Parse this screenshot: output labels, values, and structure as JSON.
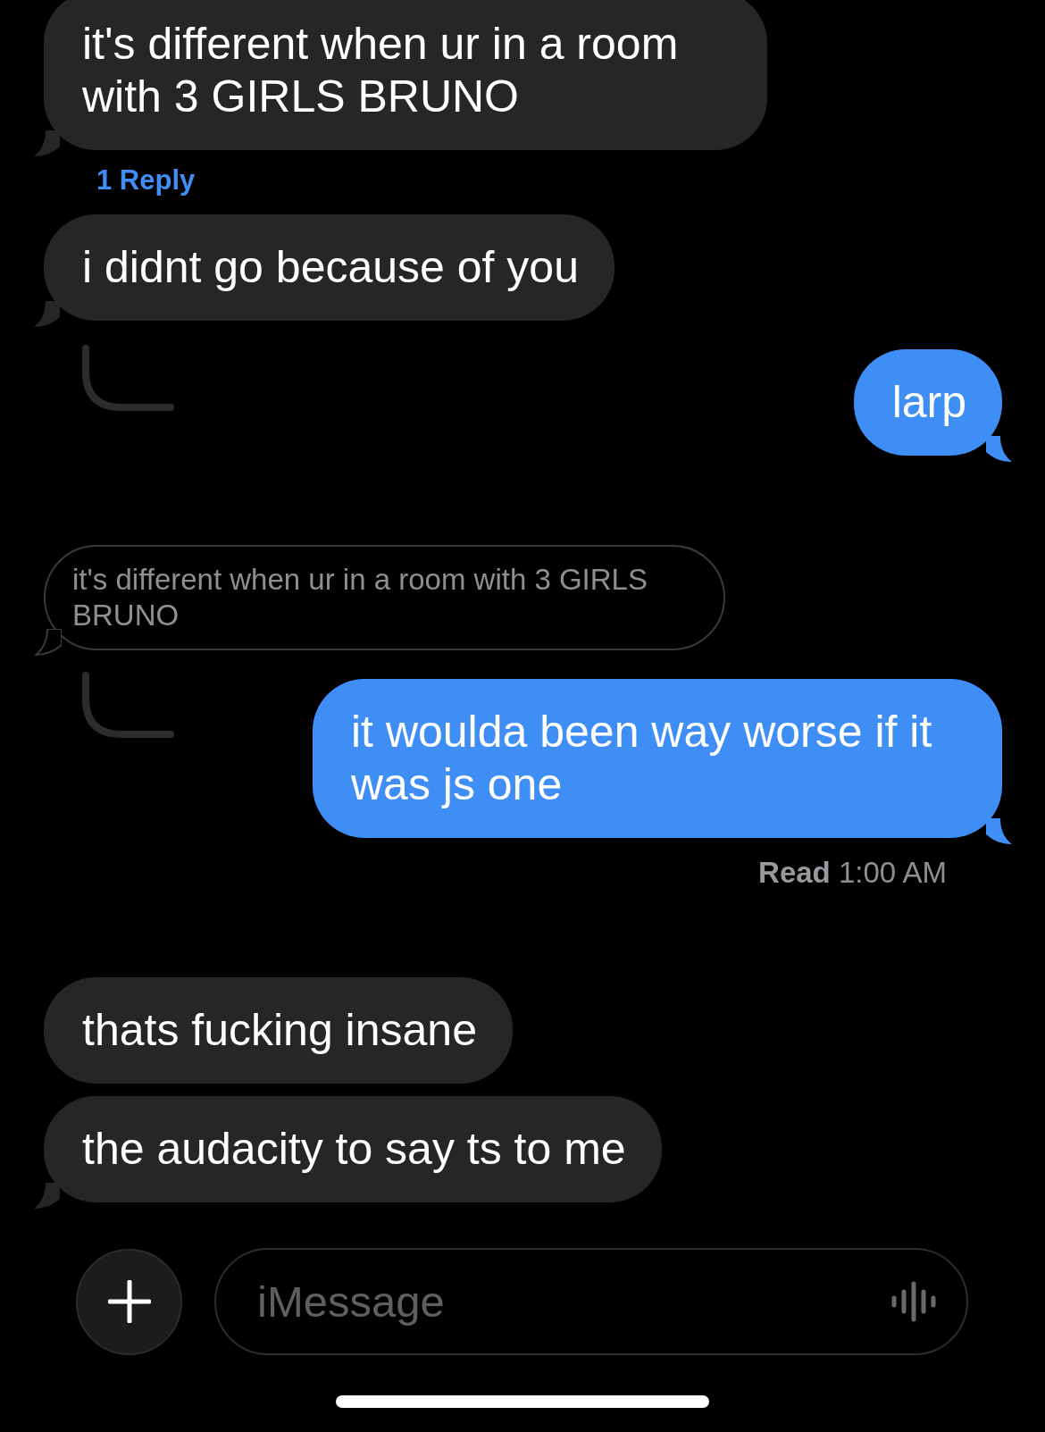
{
  "messages": [
    {
      "kind": "incoming",
      "text": "it's different when ur in a room with 3 GIRLS BRUNO",
      "tail": true
    },
    {
      "kind": "reply_link",
      "text": "1 Reply"
    },
    {
      "kind": "incoming",
      "text": "i didnt go because of you",
      "tail": true
    },
    {
      "kind": "outgoing",
      "text": "larp",
      "tail": true,
      "thread_line": true
    },
    {
      "kind": "quote",
      "text": "it's different when ur in a room with 3 GIRLS BRUNO",
      "tail": true
    },
    {
      "kind": "outgoing",
      "text": "it woulda been way worse if it was js one",
      "tail": true,
      "thread_line": true
    },
    {
      "kind": "receipt",
      "text": "**Read** 1:00 AM"
    },
    {
      "kind": "incoming",
      "text": "thats fucking insane",
      "tail": false
    },
    {
      "kind": "incoming",
      "text": "the audacity to say ts to me",
      "tail": true
    }
  ],
  "composer": {
    "placeholder": "iMessage"
  }
}
